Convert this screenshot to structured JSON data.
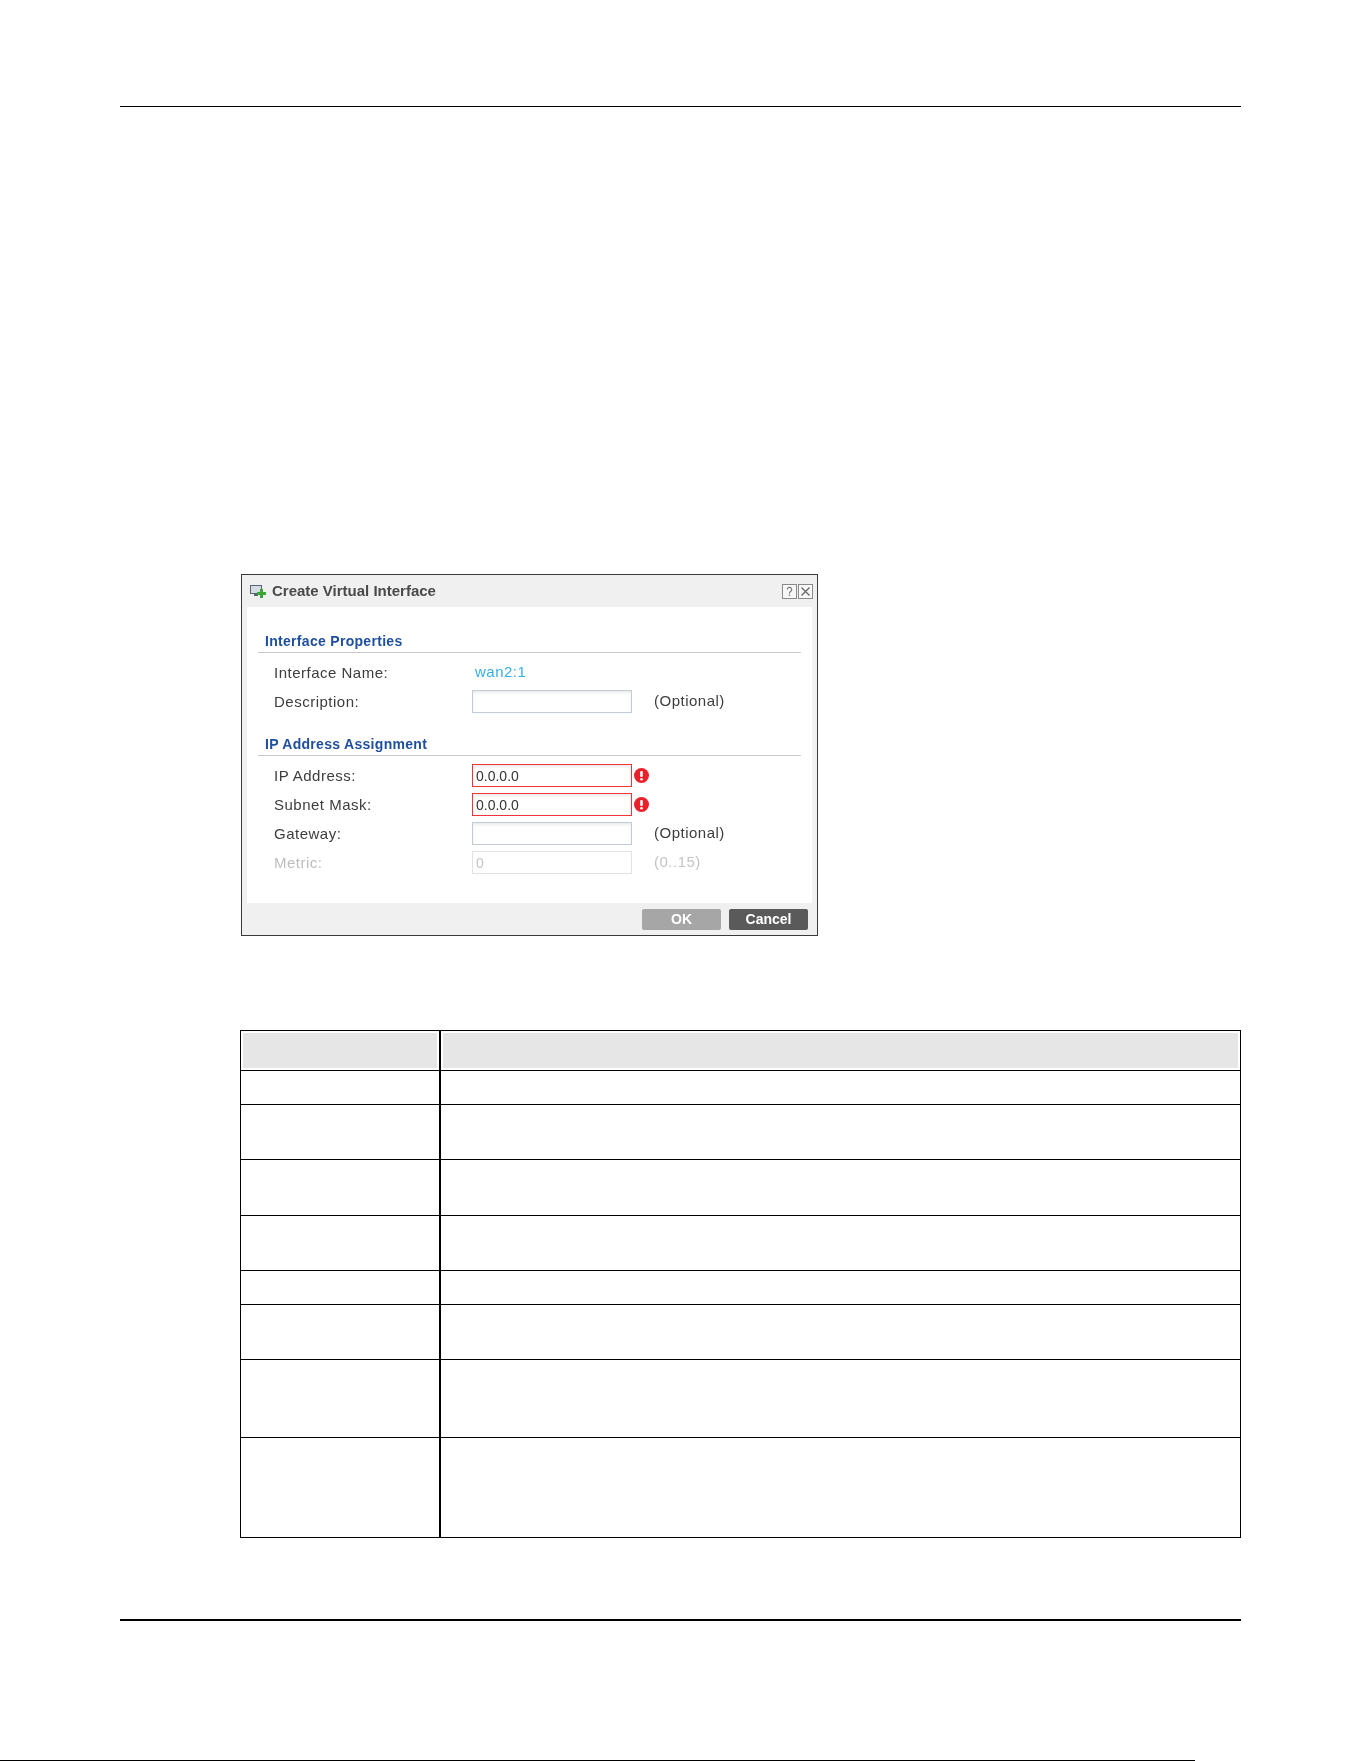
{
  "dialog": {
    "title": "Create Virtual Interface",
    "sections": [
      {
        "title": "Interface Properties",
        "rows": [
          {
            "kind": "value",
            "label": "Interface Name:",
            "value": "wan2:1",
            "error": false,
            "disabled": false
          },
          {
            "kind": "field",
            "label": "Description:",
            "note": "(Optional)",
            "error": false,
            "disabled": false
          }
        ]
      },
      {
        "title": "IP Address Assignment",
        "rows": [
          {
            "kind": "field",
            "label": "IP Address:",
            "value": "0.0.0.0",
            "error": true,
            "disabled": false
          },
          {
            "kind": "field",
            "label": "Subnet Mask:",
            "value": "0.0.0.0",
            "error": true,
            "disabled": false
          },
          {
            "kind": "field",
            "label": "Gateway:",
            "note": "(Optional)",
            "error": false,
            "disabled": false
          },
          {
            "kind": "field",
            "label": "Metric:",
            "value": "0",
            "note": "(0..15)",
            "error": false,
            "disabled": true
          }
        ]
      }
    ],
    "buttons": [
      {
        "label": "OK",
        "disabled": true
      },
      {
        "label": "Cancel",
        "disabled": false
      }
    ]
  }
}
